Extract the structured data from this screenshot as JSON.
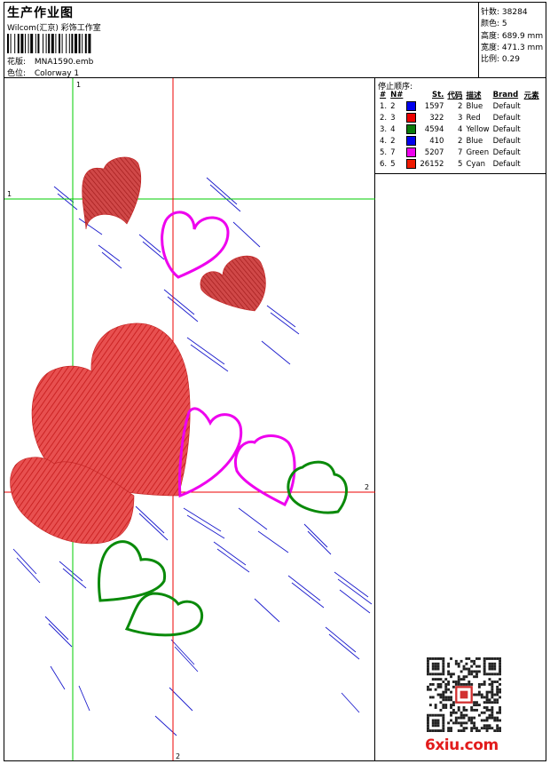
{
  "header": {
    "title": "生产作业图",
    "company": "Wilcom(汇京) 彩饰工作室",
    "design_label": "花版:",
    "design_value": "MNA1590.emb",
    "colorway_label": "色位:",
    "colorway_value": "Colorway 1"
  },
  "stats": [
    {
      "label": "针数:",
      "value": "38284"
    },
    {
      "label": "颜色:",
      "value": "5"
    },
    {
      "label": "高度:",
      "value": "689.9 mm"
    },
    {
      "label": "宽度:",
      "value": "471.3 mm"
    },
    {
      "label": "比例:",
      "value": "0.29"
    }
  ],
  "stop_sequence": {
    "title": "停止顺序:",
    "columns": [
      "#",
      "N#",
      "St.",
      "代码",
      "描述",
      "Brand",
      "元素"
    ],
    "rows": [
      {
        "idx": "1.",
        "n": "2",
        "color": "#0000ee",
        "st": "1597",
        "code": "2",
        "desc": "Blue",
        "brand": "Default"
      },
      {
        "idx": "2.",
        "n": "3",
        "color": "#ee0000",
        "st": "322",
        "code": "3",
        "desc": "Red",
        "brand": "Default"
      },
      {
        "idx": "3.",
        "n": "4",
        "color": "#0a7a0a",
        "st": "4594",
        "code": "4",
        "desc": "Yellow",
        "brand": "Default"
      },
      {
        "idx": "4.",
        "n": "2",
        "color": "#0000ee",
        "st": "410",
        "code": "2",
        "desc": "Blue",
        "brand": "Default"
      },
      {
        "idx": "5.",
        "n": "7",
        "color": "#ee00ee",
        "st": "5207",
        "code": "7",
        "desc": "Green",
        "brand": "Default"
      },
      {
        "idx": "6.",
        "n": "5",
        "color": "#ee1a00",
        "st": "26152",
        "code": "5",
        "desc": "Cyan",
        "brand": "Default"
      }
    ]
  },
  "canvas": {
    "guide_labels": {
      "green_v": "1",
      "green_h": "1",
      "red_h": "2",
      "red_v": "2"
    },
    "colors": {
      "green_guide": "#00cc00",
      "red_guide": "#ee0000",
      "heart_fill": "#dd2a2a",
      "pink_outline": "#ee00ee",
      "green_outline": "#0a8a0a",
      "blue_stitch": "#1a1acc"
    }
  },
  "watermark": {
    "logo_text": "6xiu.com",
    "qr_icon": "qr-code-icon"
  }
}
